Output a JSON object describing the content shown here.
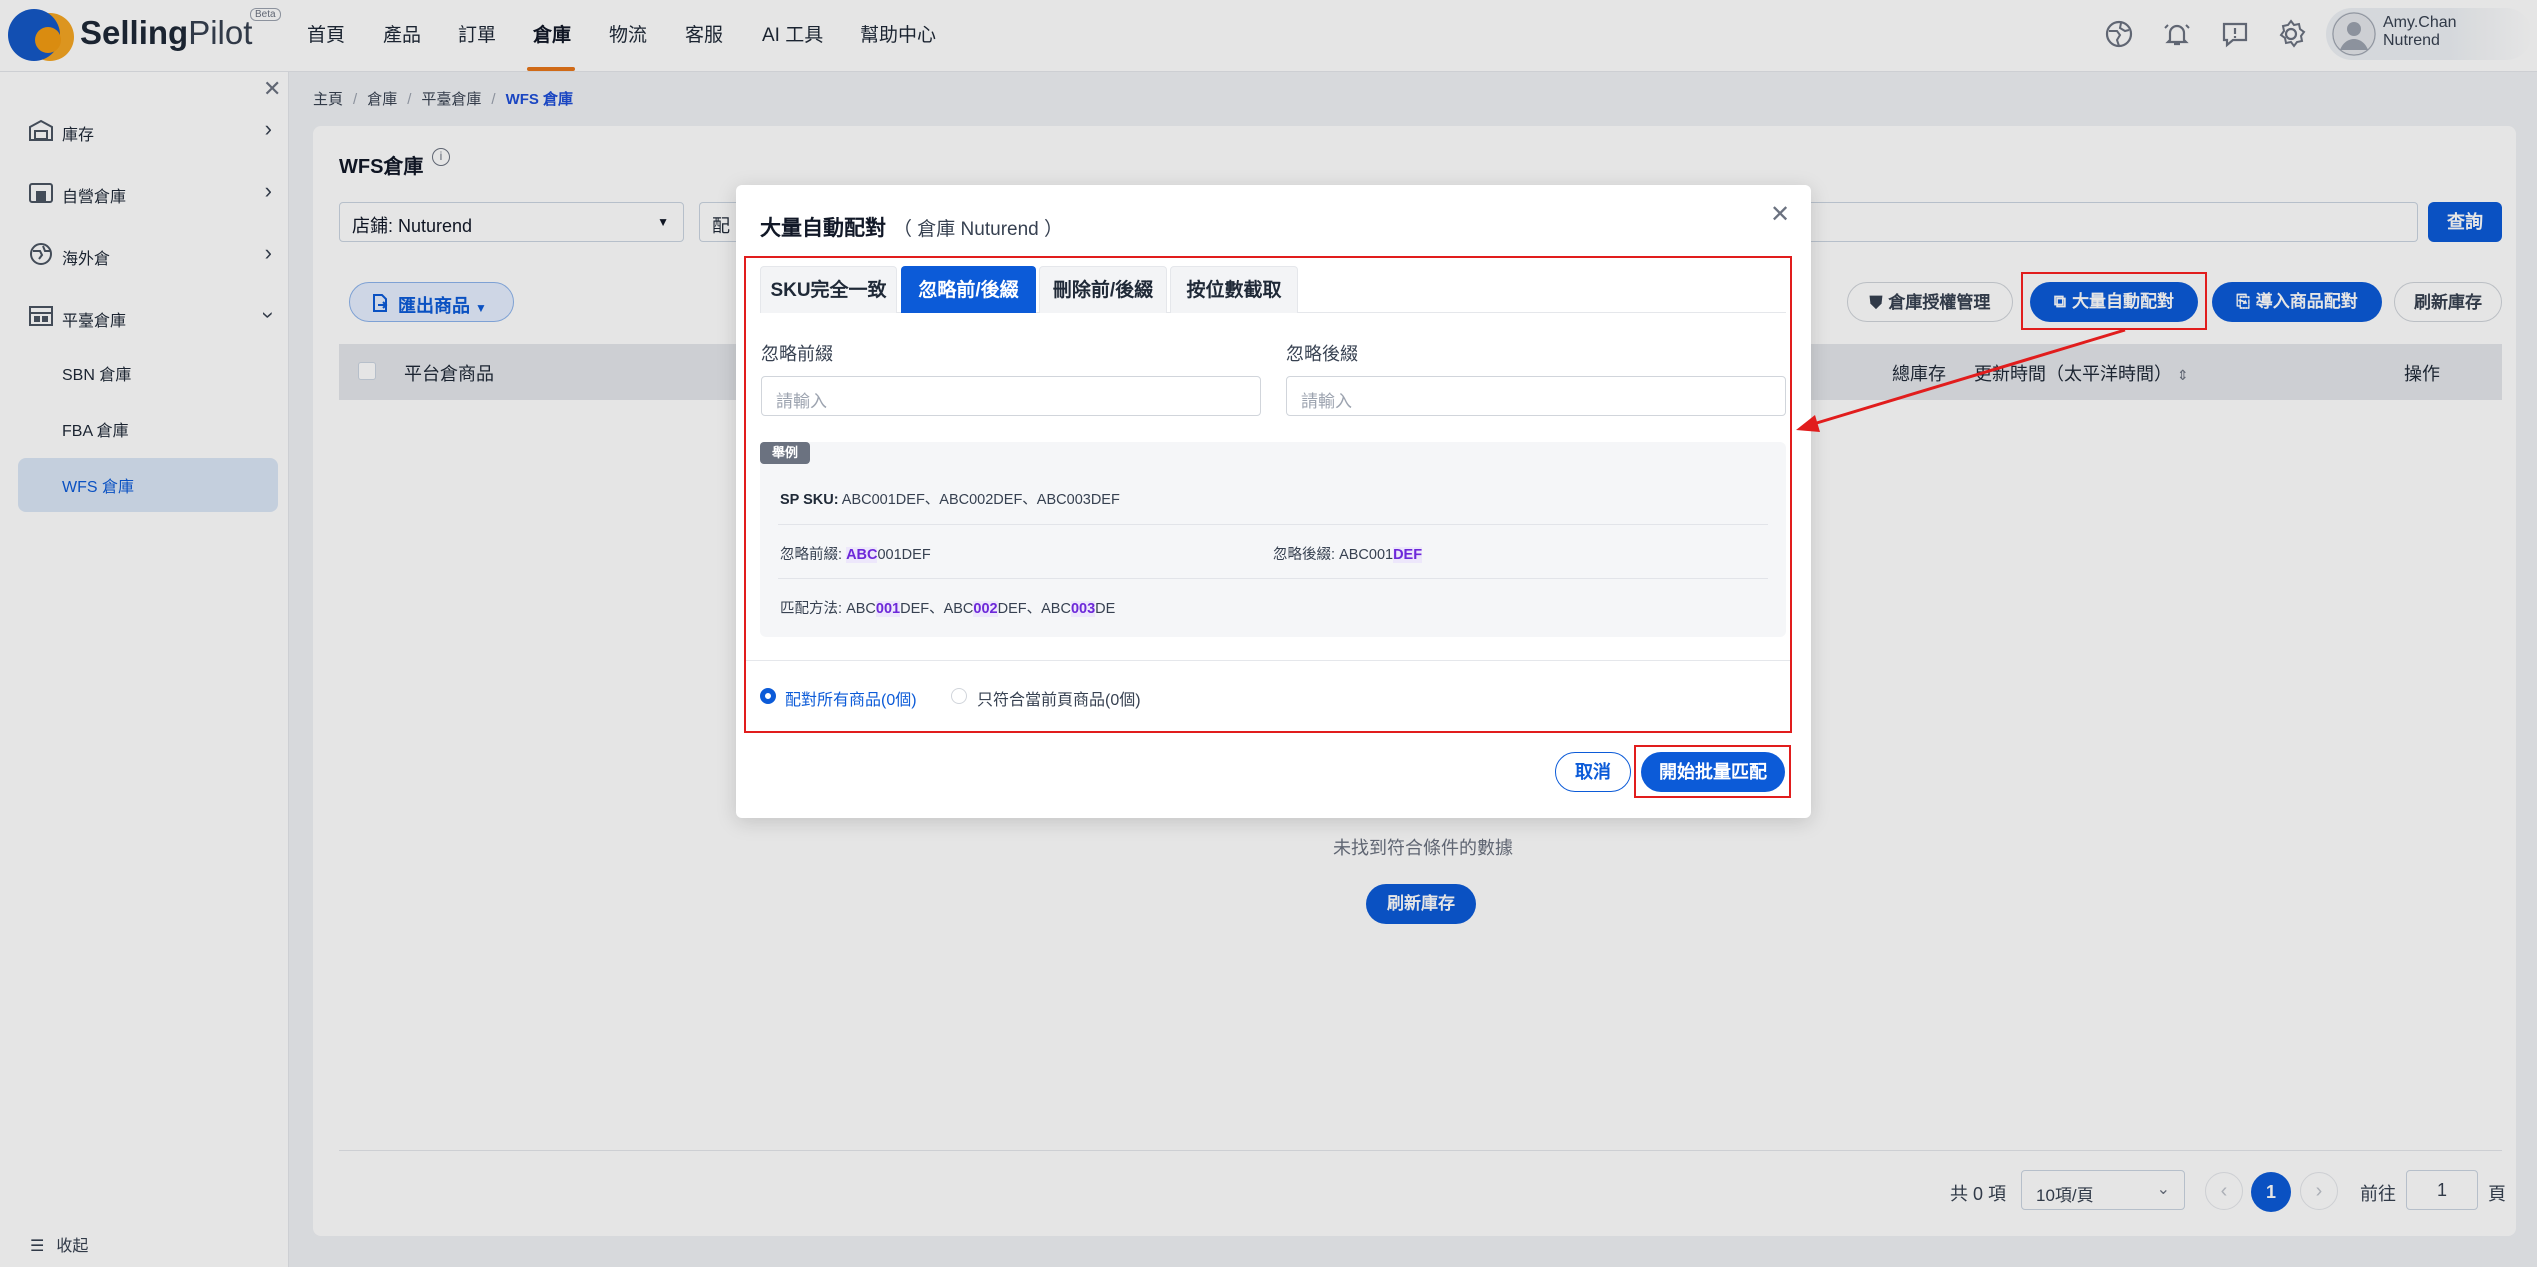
{
  "app": {
    "brand_bold": "Selling",
    "brand_light": "Pilot",
    "beta": "Beta"
  },
  "nav": {
    "items": [
      "首頁",
      "產品",
      "訂單",
      "倉庫",
      "物流",
      "客服",
      "AI 工具",
      "幫助中心"
    ],
    "active": "倉庫"
  },
  "user": {
    "name": "Amy.Chan",
    "org": "Nutrend"
  },
  "sidebar": {
    "items": [
      {
        "label": "庫存"
      },
      {
        "label": "自營倉庫"
      },
      {
        "label": "海外倉"
      },
      {
        "label": "平臺倉庫"
      }
    ],
    "sub_items": [
      "SBN 倉庫",
      "FBA 倉庫",
      "WFS 倉庫"
    ],
    "collapse_label": "收起"
  },
  "breadcrumb": [
    "主頁",
    "倉庫",
    "平臺倉庫",
    "WFS 倉庫"
  ],
  "page": {
    "title": "WFS倉庫",
    "store_select": "店鋪: Nuturend",
    "filter2": "配",
    "query_label": "查詢",
    "export_label": "匯出商品",
    "auth_label": "倉庫授權管理",
    "bulk_label": "大量自動配對",
    "import_label": "導入商品配對",
    "refresh_label": "刷新庫存"
  },
  "table": {
    "headers": {
      "product": "平台倉商品",
      "total_stock": "總庫存",
      "updated": "更新時間（太平洋時間）",
      "actions": "操作"
    },
    "empty_text": "未找到符合條件的數據",
    "empty_refresh": "刷新庫存"
  },
  "pagination": {
    "total": "共 0 項",
    "page_size": "10項/頁",
    "current": "1",
    "goto_label": "前往",
    "goto_value": "1",
    "page_suffix": "頁"
  },
  "modal": {
    "title": "大量自動配對",
    "subtitle": "（ 倉庫 Nuturend ）",
    "tabs": [
      "SKU完全一致",
      "忽略前/後綴",
      "刪除前/後綴",
      "按位數截取"
    ],
    "active_tab": "忽略前/後綴",
    "prefix_label": "忽略前綴",
    "suffix_label": "忽略後綴",
    "prefix_placeholder": "請輸入",
    "suffix_placeholder": "請輸入",
    "example": {
      "badge": "舉例",
      "sku_label": "SP SKU:",
      "sku_value": "ABC001DEF、ABC002DEF、ABC003DEF",
      "prefix_label": "忽略前綴:",
      "prefix_hl": "ABC",
      "prefix_rest": "001DEF",
      "suffix_label": "忽略後綴:",
      "suffix_rest": "ABC001",
      "suffix_hl": "DEF",
      "match_label": "匹配方法:",
      "m1a": "ABC",
      "m1b": "001",
      "m1c": "DEF、",
      "m2a": "ABC",
      "m2b": "002",
      "m2c": "DEF、",
      "m3a": "ABC",
      "m3b": "003",
      "m3c": "DE"
    },
    "radio_all": "配對所有商品(0個)",
    "radio_page": "只符合當前頁商品(0個)",
    "cancel_label": "取消",
    "start_label": "開始批量匹配"
  },
  "colors": {
    "primary": "#0c5bd8",
    "annotation": "#e11d1d",
    "nav_accent": "#e8771a"
  }
}
